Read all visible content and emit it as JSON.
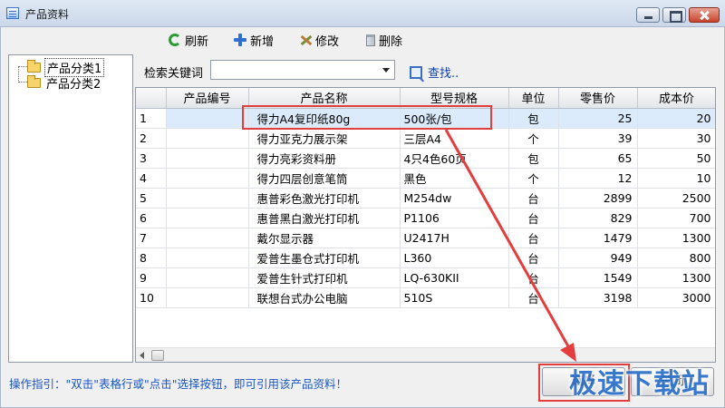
{
  "window": {
    "title": "产品资料"
  },
  "toolbar": {
    "refresh_label": "刷新",
    "add_label": "新增",
    "edit_label": "修改",
    "delete_label": "删除"
  },
  "tree": {
    "items": [
      {
        "label": "产品分类1"
      },
      {
        "label": "产品分类2"
      }
    ]
  },
  "search": {
    "label": "检索关键词",
    "value": "",
    "button_label": "查找.."
  },
  "table": {
    "columns": [
      "",
      "产品编号",
      "产品名称",
      "型号规格",
      "单位",
      "零售价",
      "成本价"
    ],
    "rows": [
      [
        "1",
        "",
        "得力A4复印纸80g",
        "500张/包",
        "包",
        "25",
        "20"
      ],
      [
        "2",
        "",
        "得力亚克力展示架",
        "三层A4",
        "个",
        "39",
        "30"
      ],
      [
        "3",
        "",
        "得力亮彩资料册",
        "4只4色60页",
        "包",
        "65",
        "50"
      ],
      [
        "4",
        "",
        "得力四层创意笔筒",
        "黑色",
        "个",
        "12",
        "10"
      ],
      [
        "5",
        "",
        "惠普彩色激光打印机",
        "M254dw",
        "台",
        "2899",
        "2500"
      ],
      [
        "6",
        "",
        "惠普黑白激光打印机",
        "P1106",
        "台",
        "829",
        "700"
      ],
      [
        "7",
        "",
        "戴尔显示器",
        "U2417H",
        "台",
        "1479",
        "1300"
      ],
      [
        "8",
        "",
        "爱普生墨仓式打印机",
        "L360",
        "台",
        "949",
        "800"
      ],
      [
        "9",
        "",
        "爱普生针式打印机",
        "LQ-630KII",
        "台",
        "1549",
        "1300"
      ],
      [
        "10",
        "",
        "联想台式办公电脑",
        "510S",
        "台",
        "3198",
        "3000"
      ]
    ],
    "selected_row": 0
  },
  "status": {
    "tip": "操作指引：\"双击\"表格行或\"点击\"选择按钮，即可引用该产品资料！"
  },
  "buttons": {
    "ok_label": "选择",
    "cancel_label": "关闭"
  },
  "watermark": {
    "text": "极速下载站"
  },
  "colors": {
    "highlight": "#e33d3d",
    "selected_row": "#dcebfc",
    "link": "#1a56c4",
    "watermark": "#2a6fc9"
  },
  "icons": {
    "refresh": "refresh-icon",
    "add": "add-icon",
    "edit": "edit-icon",
    "delete": "trash-icon",
    "search": "search-icon",
    "folder": "folder-icon"
  }
}
